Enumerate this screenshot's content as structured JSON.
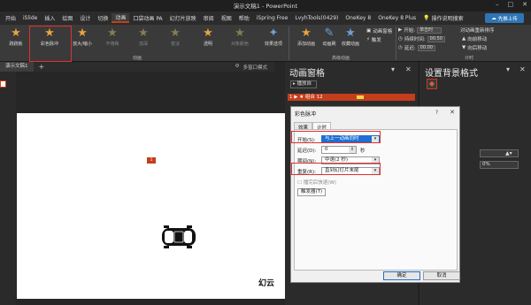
{
  "title_bar": {
    "title": "演示文稿1  -  PowerPoint",
    "buttons": [
      "–",
      "□",
      "✕"
    ]
  },
  "menu": {
    "items": [
      "开始",
      "iSlide",
      "插入",
      "绘图",
      "设计",
      "切换",
      "动画",
      "口袋动画 PA",
      "幻灯片放映",
      "审阅",
      "视图",
      "帮助",
      "iSpring Free",
      "LvyhTools(0429)",
      "OneKey 8",
      "OneKey 8 Plus"
    ],
    "active_index": 6,
    "search_label": "操作说明搜索",
    "share_label": "先推上传"
  },
  "ribbon": {
    "effects": [
      {
        "label": "跷跷板",
        "dim": false
      },
      {
        "label": "彩色脉冲",
        "dim": false
      },
      {
        "label": "放大/缩小",
        "dim": false
      },
      {
        "label": "不饱和",
        "dim": true
      },
      {
        "label": "加深",
        "dim": true
      },
      {
        "label": "变淡",
        "dim": true
      },
      {
        "label": "透明",
        "dim": false
      },
      {
        "label": "对象颜色",
        "dim": true
      }
    ],
    "effect_options": "效果选项",
    "animation_group_label": "动画",
    "add_animation": "添加动画",
    "anim_painter": "动画刷",
    "anim_pane_btn": "动画窗格",
    "trigger": "触发",
    "advanced_group_label": "高级动画",
    "start_label": "开始:",
    "start_value": "单击时",
    "duration_label": "持续时间:",
    "duration_value": "00.50",
    "delay_label": "延迟:",
    "delay_value": "00.00",
    "reorder_label": "对动画重新排序",
    "earlier": "向前移动",
    "later": "向后移动",
    "timing_group_label": "计时"
  },
  "doc_tab": {
    "label": "演示文稿1",
    "plus": "+"
  },
  "view_mode": "多窗口模式",
  "slide": {
    "badge": "1",
    "text": "幻云"
  },
  "anim_pane": {
    "title": "动画窗格",
    "play_label": "▸ 播放自",
    "item_label": "1 ▶ ★ 组合 12"
  },
  "format_pane": {
    "title": "设置背景格式",
    "percent": "0%"
  },
  "dialog": {
    "title": "彩色脉冲",
    "help": "?",
    "close": "✕",
    "tabs": [
      "效果",
      "计时"
    ],
    "active_tab": 1,
    "start_label": "开始(S):",
    "start_value": "与上一动画同时",
    "delay_label": "延迟(D):",
    "delay_value": "0",
    "delay_unit": "秒",
    "period_label": "期间(N):",
    "period_value": "中速(2 秒)",
    "repeat_label": "重复(R):",
    "repeat_value": "直到幻灯片末尾",
    "rewind_label": "播完后快退(W)",
    "trigger_label": "触发器(T)",
    "ok": "确定",
    "cancel": "取消"
  },
  "colors": {
    "accent": "#c43e1c",
    "select_blue": "#1e6fd0",
    "highlight": "#e03030"
  }
}
